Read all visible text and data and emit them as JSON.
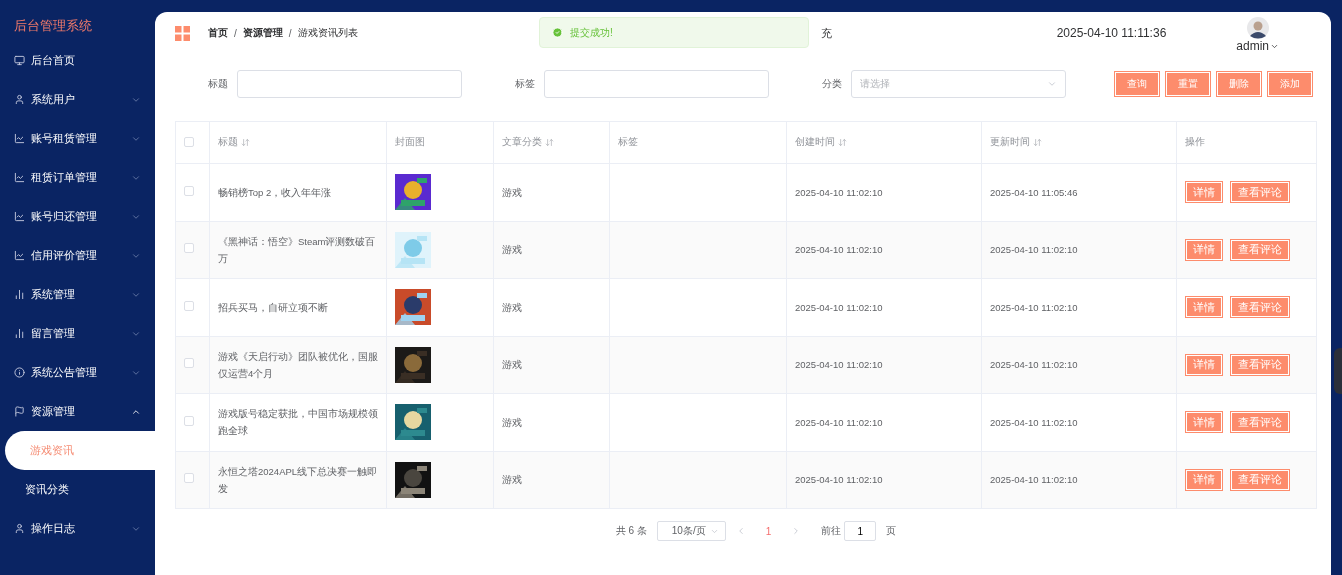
{
  "sidebar": {
    "title": "后台管理系统",
    "items": [
      {
        "label": "后台首页"
      },
      {
        "label": "系统用户",
        "expanded": false
      },
      {
        "label": "账号租赁管理",
        "expanded": false
      },
      {
        "label": "租赁订单管理",
        "expanded": false
      },
      {
        "label": "账号归还管理",
        "expanded": false
      },
      {
        "label": "信用评价管理",
        "expanded": false
      },
      {
        "label": "系统管理",
        "expanded": false
      },
      {
        "label": "留言管理",
        "expanded": false
      },
      {
        "label": "系统公告管理",
        "expanded": false
      },
      {
        "label": "资源管理",
        "expanded": true,
        "children": [
          {
            "label": "游戏资讯",
            "selected": true
          },
          {
            "label": "资讯分类",
            "selected": false
          }
        ]
      },
      {
        "label": "操作日志",
        "expanded": false
      }
    ]
  },
  "header": {
    "breadcrumb": [
      {
        "label": "首页"
      },
      {
        "separator": "/",
        "label": "资源管理"
      },
      {
        "separator": "/",
        "label": "游戏资讯列表"
      }
    ],
    "title": "充",
    "datetime": "2025-04-10 11:11:36",
    "user": "admin"
  },
  "toast": {
    "message": "提交成功!"
  },
  "filters": [
    {
      "label": "标题",
      "kind": "input"
    },
    {
      "label": "标签",
      "kind": "input"
    },
    {
      "label": "分类",
      "kind": "select",
      "placeholder": "请选择"
    }
  ],
  "actions": [
    "查询",
    "重置",
    "删除",
    "添加"
  ],
  "table": {
    "all_checked": false,
    "columns": [
      {
        "label": "标题",
        "sortable": true
      },
      {
        "label": "封面图",
        "sortable": false
      },
      {
        "label": "文章分类",
        "sortable": true
      },
      {
        "label": "标签",
        "sortable": false
      },
      {
        "label": "创建时间",
        "sortable": true
      },
      {
        "label": "更新时间",
        "sortable": true
      },
      {
        "label": "操作",
        "sortable": false
      }
    ],
    "rows": [
      {
        "checked": false,
        "title": "畅销榜Top 2，收入年年涨",
        "cover": {
          "kind": "picture"
        },
        "category": "游戏",
        "created": "2025-04-10 11:02:10",
        "updated": "2025-04-10 11:05:46",
        "buttons": [
          "详情",
          "查看评论"
        ]
      },
      {
        "checked": false,
        "title": "《黑神话：悟空》Steam评测数破百万",
        "cover": {
          "kind": "picture"
        },
        "category": "游戏",
        "created": "2025-04-10 11:02:10",
        "updated": "2025-04-10 11:02:10",
        "buttons": [
          "详情",
          "查看评论"
        ]
      },
      {
        "checked": false,
        "title": "招兵买马，自研立项不断",
        "cover": {
          "kind": "picture"
        },
        "category": "游戏",
        "created": "2025-04-10 11:02:10",
        "updated": "2025-04-10 11:02:10",
        "buttons": [
          "详情",
          "查看评论"
        ]
      },
      {
        "checked": false,
        "title": "游戏《天启行动》团队被优化，国服仅运营4个月",
        "cover": {
          "kind": "picture"
        },
        "category": "游戏",
        "created": "2025-04-10 11:02:10",
        "updated": "2025-04-10 11:02:10",
        "buttons": [
          "详情",
          "查看评论"
        ]
      },
      {
        "checked": false,
        "title": "游戏版号稳定获批，中国市场规模领跑全球",
        "cover": {
          "kind": "picture"
        },
        "category": "游戏",
        "created": "2025-04-10 11:02:10",
        "updated": "2025-04-10 11:02:10",
        "buttons": [
          "详情",
          "查看评论"
        ]
      },
      {
        "checked": false,
        "title": "永恒之塔2024APL线下总决赛一触即发",
        "cover": {
          "kind": "picture"
        },
        "category": "游戏",
        "created": "2025-04-10 11:02:10",
        "updated": "2025-04-10 11:02:10",
        "buttons": [
          "详情",
          "查看评论"
        ]
      }
    ]
  },
  "pagination": {
    "total": "共 6 条",
    "page_size": "10条/页",
    "pages": [
      {
        "label": "1",
        "selected": true
      }
    ],
    "goto_label": "前往",
    "goto_value": "1",
    "goto_suffix": "页"
  }
}
